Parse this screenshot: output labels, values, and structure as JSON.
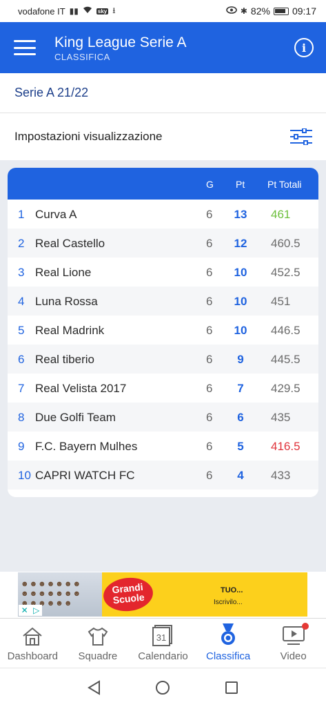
{
  "status_bar": {
    "carrier": "vodafone IT",
    "sky": "sky",
    "battery": "82%",
    "time": "09:17"
  },
  "app_bar": {
    "title": "King League Serie A",
    "subtitle": "CLASSIFICA"
  },
  "season": "Serie A 21/22",
  "settings_label": "Impostazioni visualizzazione",
  "table": {
    "headers": {
      "g": "G",
      "pt": "Pt",
      "total": "Pt Totali"
    },
    "rows": [
      {
        "rank": "1",
        "team": "Curva A",
        "g": "6",
        "pt": "13",
        "total": "461"
      },
      {
        "rank": "2",
        "team": "Real Castello",
        "g": "6",
        "pt": "12",
        "total": "460.5"
      },
      {
        "rank": "3",
        "team": "Real Lione",
        "g": "6",
        "pt": "10",
        "total": "452.5"
      },
      {
        "rank": "4",
        "team": "Luna Rossa",
        "g": "6",
        "pt": "10",
        "total": "451"
      },
      {
        "rank": "5",
        "team": "Real Madrink",
        "g": "6",
        "pt": "10",
        "total": "446.5"
      },
      {
        "rank": "6",
        "team": "Real tiberio",
        "g": "6",
        "pt": "9",
        "total": "445.5"
      },
      {
        "rank": "7",
        "team": "Real Velista 2017",
        "g": "6",
        "pt": "7",
        "total": "429.5"
      },
      {
        "rank": "8",
        "team": "Due Golfi Team",
        "g": "6",
        "pt": "6",
        "total": "435"
      },
      {
        "rank": "9",
        "team": "F.C. Bayern Mulhes",
        "g": "6",
        "pt": "5",
        "total": "416.5"
      },
      {
        "rank": "10",
        "team": "CAPRI WATCH FC",
        "g": "6",
        "pt": "4",
        "total": "433"
      }
    ],
    "highlight_colors": {
      "best_total": "#6cbf3b",
      "worst_total": "#e0333b"
    }
  },
  "ad": {
    "logo_line1": "Grandi",
    "logo_line2": "Scuole",
    "title": "TUO...",
    "cta": "Iscrivilo..."
  },
  "bottom_nav": [
    {
      "label": "Dashboard",
      "icon": "home-icon",
      "active": false
    },
    {
      "label": "Squadre",
      "icon": "shirt-icon",
      "active": false
    },
    {
      "label": "Calendario",
      "icon": "calendar-icon",
      "active": false,
      "badge": "31"
    },
    {
      "label": "Classifica",
      "icon": "medal-icon",
      "active": true
    },
    {
      "label": "Video",
      "icon": "video-icon",
      "active": false,
      "notification": true
    }
  ],
  "colors": {
    "primary": "#1f63e0",
    "background": "#e9ecf1"
  }
}
